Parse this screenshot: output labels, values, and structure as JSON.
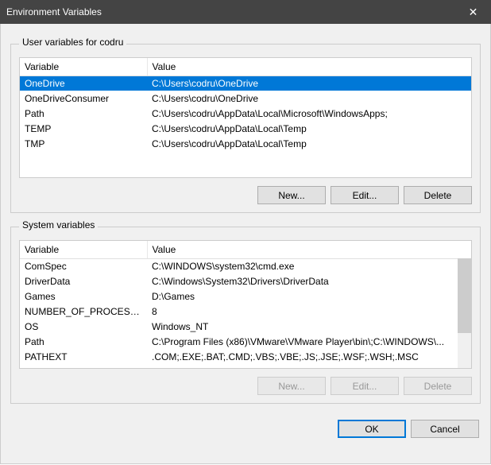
{
  "window": {
    "title": "Environment Variables",
    "close_label": "✕"
  },
  "user_section": {
    "legend": "User variables for codru",
    "columns": {
      "variable": "Variable",
      "value": "Value"
    },
    "rows": [
      {
        "variable": "OneDrive",
        "value": "C:\\Users\\codru\\OneDrive",
        "selected": true
      },
      {
        "variable": "OneDriveConsumer",
        "value": "C:\\Users\\codru\\OneDrive",
        "selected": false
      },
      {
        "variable": "Path",
        "value": "C:\\Users\\codru\\AppData\\Local\\Microsoft\\WindowsApps;",
        "selected": false
      },
      {
        "variable": "TEMP",
        "value": "C:\\Users\\codru\\AppData\\Local\\Temp",
        "selected": false
      },
      {
        "variable": "TMP",
        "value": "C:\\Users\\codru\\AppData\\Local\\Temp",
        "selected": false
      }
    ],
    "buttons": {
      "new": "New...",
      "edit": "Edit...",
      "delete": "Delete"
    }
  },
  "system_section": {
    "legend": "System variables",
    "columns": {
      "variable": "Variable",
      "value": "Value"
    },
    "rows": [
      {
        "variable": "ComSpec",
        "value": "C:\\WINDOWS\\system32\\cmd.exe"
      },
      {
        "variable": "DriverData",
        "value": "C:\\Windows\\System32\\Drivers\\DriverData"
      },
      {
        "variable": "Games",
        "value": "D:\\Games"
      },
      {
        "variable": "NUMBER_OF_PROCESSORS",
        "value": "8"
      },
      {
        "variable": "OS",
        "value": "Windows_NT"
      },
      {
        "variable": "Path",
        "value": "C:\\Program Files (x86)\\VMware\\VMware Player\\bin\\;C:\\WINDOWS\\..."
      },
      {
        "variable": "PATHEXT",
        "value": ".COM;.EXE;.BAT;.CMD;.VBS;.VBE;.JS;.JSE;.WSF;.WSH;.MSC"
      }
    ],
    "buttons": {
      "new": "New...",
      "edit": "Edit...",
      "delete": "Delete"
    },
    "buttons_disabled": true
  },
  "footer": {
    "ok": "OK",
    "cancel": "Cancel"
  }
}
